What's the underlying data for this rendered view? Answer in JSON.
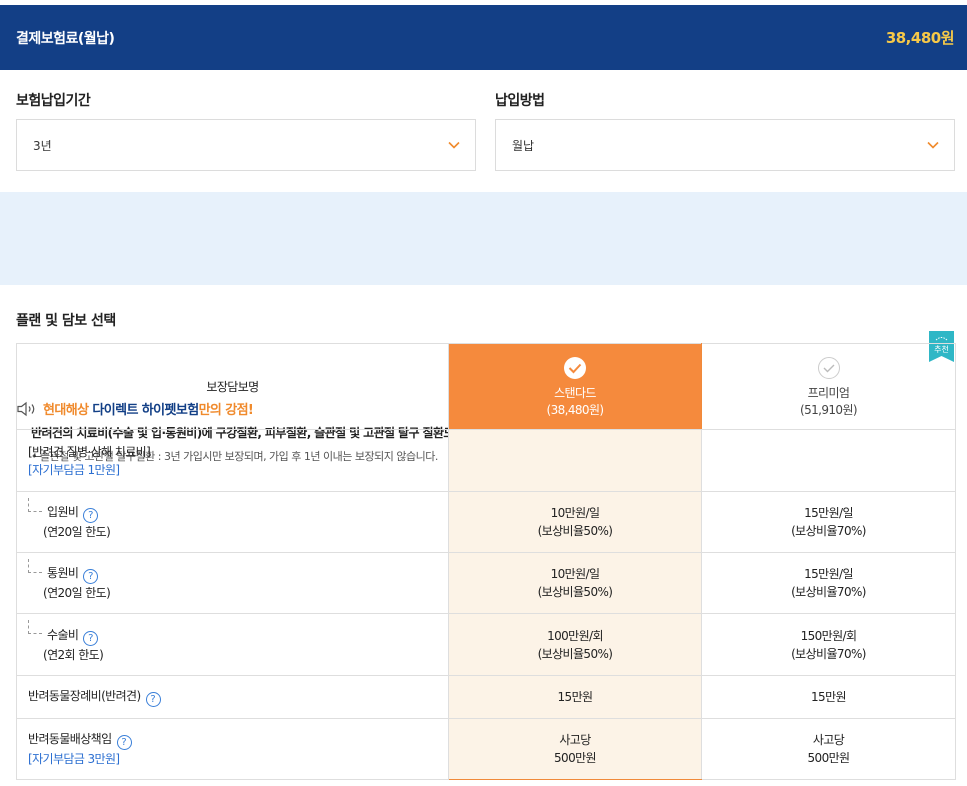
{
  "header": {
    "title": "결제보험료(월납)",
    "price": "38,480원"
  },
  "period": {
    "label": "보험납입기간",
    "value": "3년"
  },
  "method": {
    "label": "납입방법",
    "value": "월납"
  },
  "notice": {
    "brand": "현대해상",
    "product": "다이렉트 하이펫보험",
    "suffix": "만의 강점!",
    "desc": "반려견의 치료비(수술 및 입·통원비)에 구강질환, 피부질환, 슬관절 및 고관절 탈구 질환도 보장해 드립니다.",
    "footnote": "• 슬관절 및 고관절 탈구질환 : 3년 가입시만 보장되며, 가입 후 1년 이내는 보장되지 않습니다."
  },
  "plan_section": {
    "title": "플랜 및 담보 선택",
    "badge": "추천",
    "col_name": "보장담보명",
    "plans": [
      {
        "name": "스탠다드",
        "price": "(38,480원)"
      },
      {
        "name": "프리미엄",
        "price": "(51,910원)"
      }
    ],
    "rows": [
      {
        "title": "[반려견 질병·상해 치료비]",
        "sub": "[자기부담금 1만원]",
        "std1": "",
        "std2": "",
        "prem1": "",
        "prem2": ""
      },
      {
        "title": "입원비",
        "sub": "(연20일 한도)",
        "std1": "10만원/일",
        "std2": "(보상비율50%)",
        "prem1": "15만원/일",
        "prem2": "(보상비율70%)"
      },
      {
        "title": "통원비",
        "sub": "(연20일 한도)",
        "std1": "10만원/일",
        "std2": "(보상비율50%)",
        "prem1": "15만원/일",
        "prem2": "(보상비율70%)"
      },
      {
        "title": "수술비",
        "sub": "(연2회 한도)",
        "std1": "100만원/회",
        "std2": "(보상비율50%)",
        "prem1": "150만원/회",
        "prem2": "(보상비율70%)"
      },
      {
        "title": "반려동물장례비(반려견)",
        "sub": "",
        "std1": "15만원",
        "std2": "",
        "prem1": "15만원",
        "prem2": ""
      },
      {
        "title": "반려동물배상책임",
        "sub": "[자기부담금 3만원]",
        "std1": "사고당",
        "std2": "500만원",
        "prem1": "사고당",
        "prem2": "500만원"
      }
    ]
  },
  "colors": {
    "header_bg": "#133f86",
    "price": "#f7c948",
    "accent_orange": "#f58a3d",
    "notice_bg": "#e7f1fb",
    "badge": "#2fb7c6"
  },
  "icons": [
    "chevron-down-icon",
    "speaker-icon",
    "check-circle-icon",
    "question-icon",
    "recommend-badge-icon"
  ]
}
